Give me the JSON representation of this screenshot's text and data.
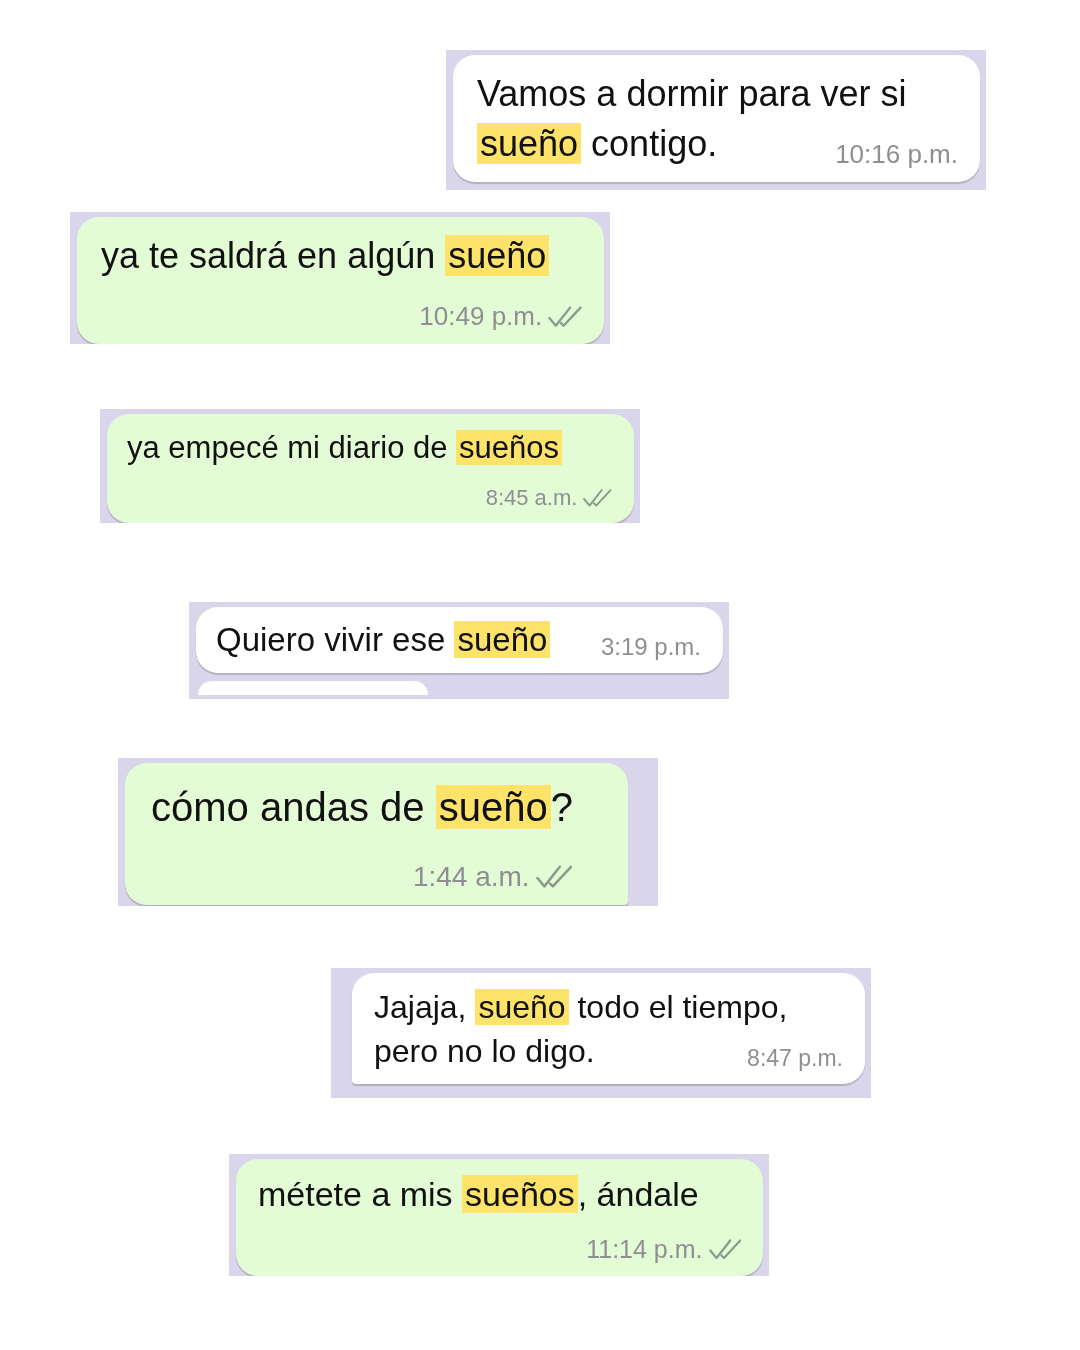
{
  "messages": [
    {
      "kind": "incoming",
      "segments": [
        {
          "text": "Vamos a dormir para ver si ",
          "highlight": false
        },
        {
          "text": "sueño",
          "highlight": true
        },
        {
          "text": " contigo.",
          "highlight": false
        }
      ],
      "time": "10:16 p.m.",
      "read": false,
      "tail": false,
      "continued": false
    },
    {
      "kind": "outgoing",
      "segments": [
        {
          "text": "ya te saldrá en algún ",
          "highlight": false
        },
        {
          "text": "sueño",
          "highlight": true
        }
      ],
      "time": "10:49 p.m.",
      "read": true,
      "tail": false,
      "continued": false
    },
    {
      "kind": "outgoing",
      "segments": [
        {
          "text": "ya empecé mi diario de ",
          "highlight": false
        },
        {
          "text": "sueños",
          "highlight": true
        }
      ],
      "time": "8:45 a.m.",
      "read": true,
      "tail": false,
      "continued": false
    },
    {
      "kind": "incoming",
      "segments": [
        {
          "text": "Quiero vivir ese ",
          "highlight": false
        },
        {
          "text": "sueño",
          "highlight": true
        }
      ],
      "time": "3:19 p.m.",
      "read": false,
      "tail": false,
      "continued": true
    },
    {
      "kind": "outgoing",
      "segments": [
        {
          "text": "cómo andas de ",
          "highlight": false
        },
        {
          "text": "sueño",
          "highlight": true
        },
        {
          "text": "?",
          "highlight": false
        }
      ],
      "time": "1:44 a.m.",
      "read": true,
      "tail": true,
      "continued": false
    },
    {
      "kind": "incoming",
      "segments": [
        {
          "text": "Jajaja, ",
          "highlight": false
        },
        {
          "text": "sueño",
          "highlight": true
        },
        {
          "text": " todo el tiempo, pero no lo digo.",
          "highlight": false
        }
      ],
      "time": "8:47 p.m.",
      "read": false,
      "tail": true,
      "continued": false
    },
    {
      "kind": "outgoing",
      "segments": [
        {
          "text": "métete a mis ",
          "highlight": false
        },
        {
          "text": "sueños",
          "highlight": true
        },
        {
          "text": ", ándale",
          "highlight": false
        }
      ],
      "time": "11:14 p.m.",
      "read": true,
      "tail": false,
      "continued": false
    }
  ]
}
